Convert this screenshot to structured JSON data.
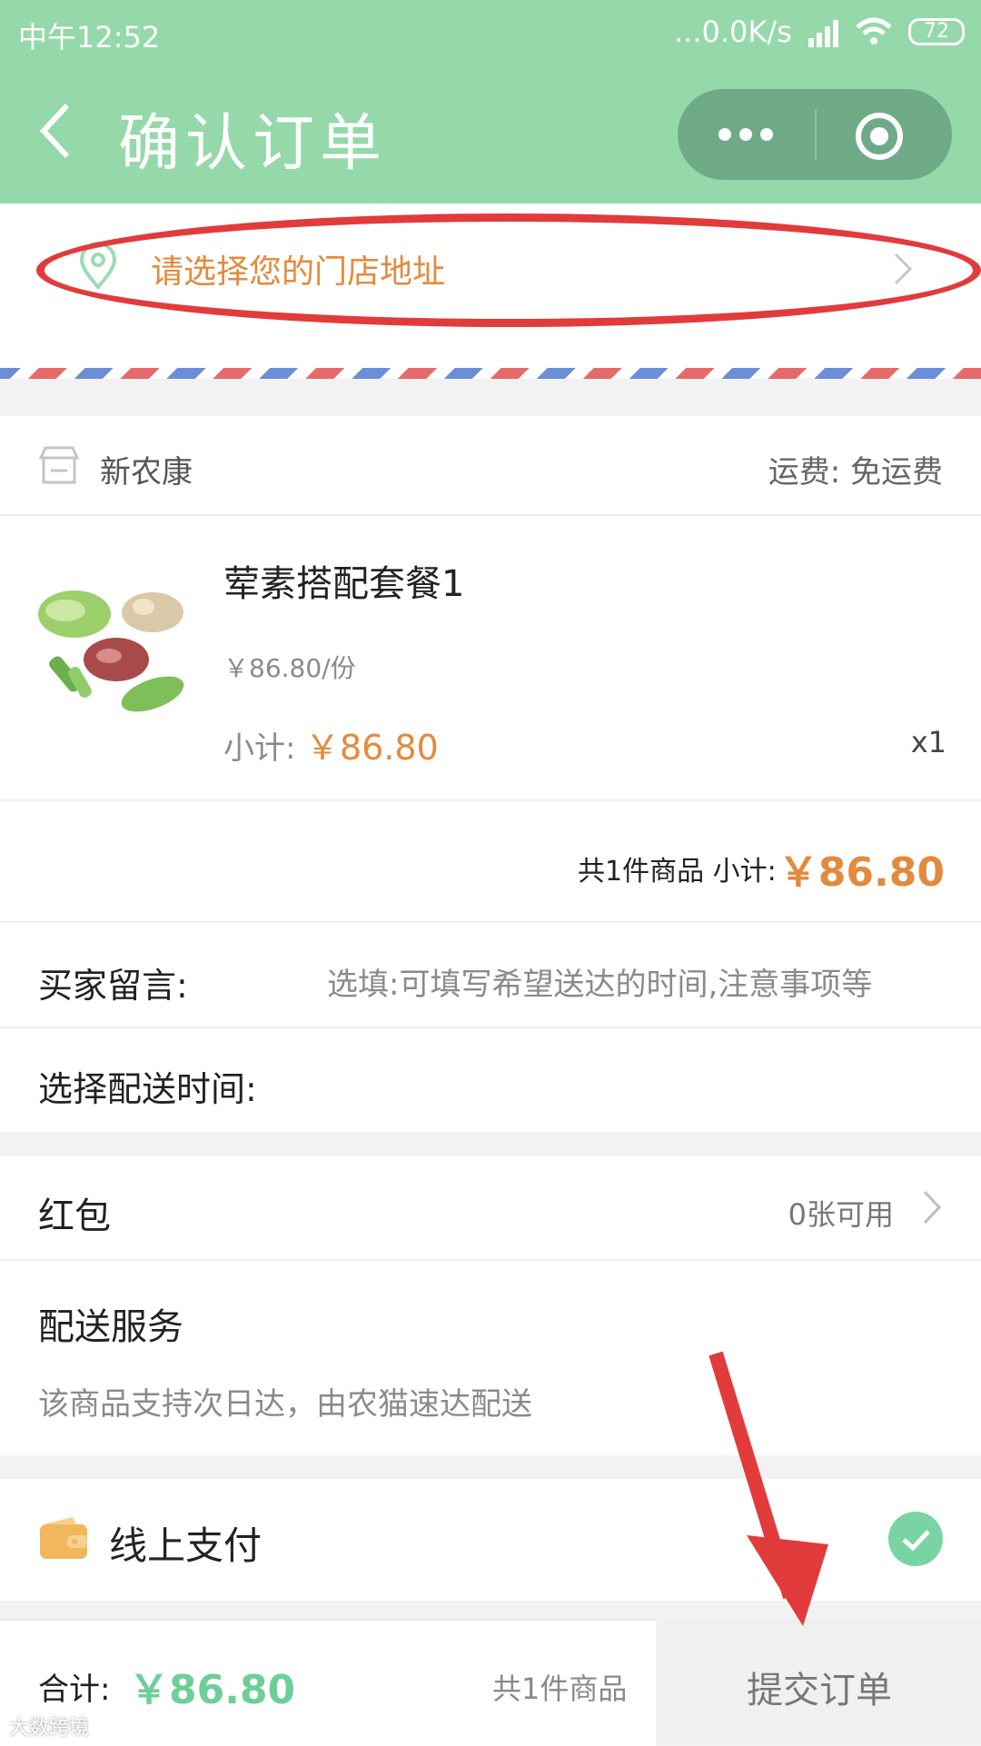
{
  "status": {
    "time": "中午12:52",
    "net": "...0.0K/s",
    "battery": "72"
  },
  "nav": {
    "title": "确认订单"
  },
  "address": {
    "placeholder": "请选择您的门店地址"
  },
  "store": {
    "name": "新农康",
    "shipping": "运费: 免运费"
  },
  "product": {
    "name": "荤素搭配套餐1",
    "unit_price": "￥86.80/份",
    "subtotal_label": "小计:",
    "subtotal": "￥86.80",
    "qty": "x1"
  },
  "summary": {
    "text": "共1件商品 小计:",
    "amount": "￥86.80"
  },
  "message": {
    "label": "买家留言:",
    "placeholder": "选填:可填写希望送达的时间,注意事项等"
  },
  "delivery_time": {
    "label": "选择配送时间:"
  },
  "redpacket": {
    "label": "红包",
    "value": "0张可用"
  },
  "service": {
    "title": "配送服务",
    "desc": "该商品支持次日达，由农猫速达配送"
  },
  "payment": {
    "label": "线上支付"
  },
  "footer": {
    "total_label": "合计:",
    "total": "￥86.80",
    "count": "共1件商品",
    "submit": "提交订单"
  },
  "watermark": "大数跨境",
  "colors": {
    "accent": "#95d8a9",
    "price": "#e38a3d",
    "total": "#6ccf97",
    "annotation": "#e23b3b"
  }
}
